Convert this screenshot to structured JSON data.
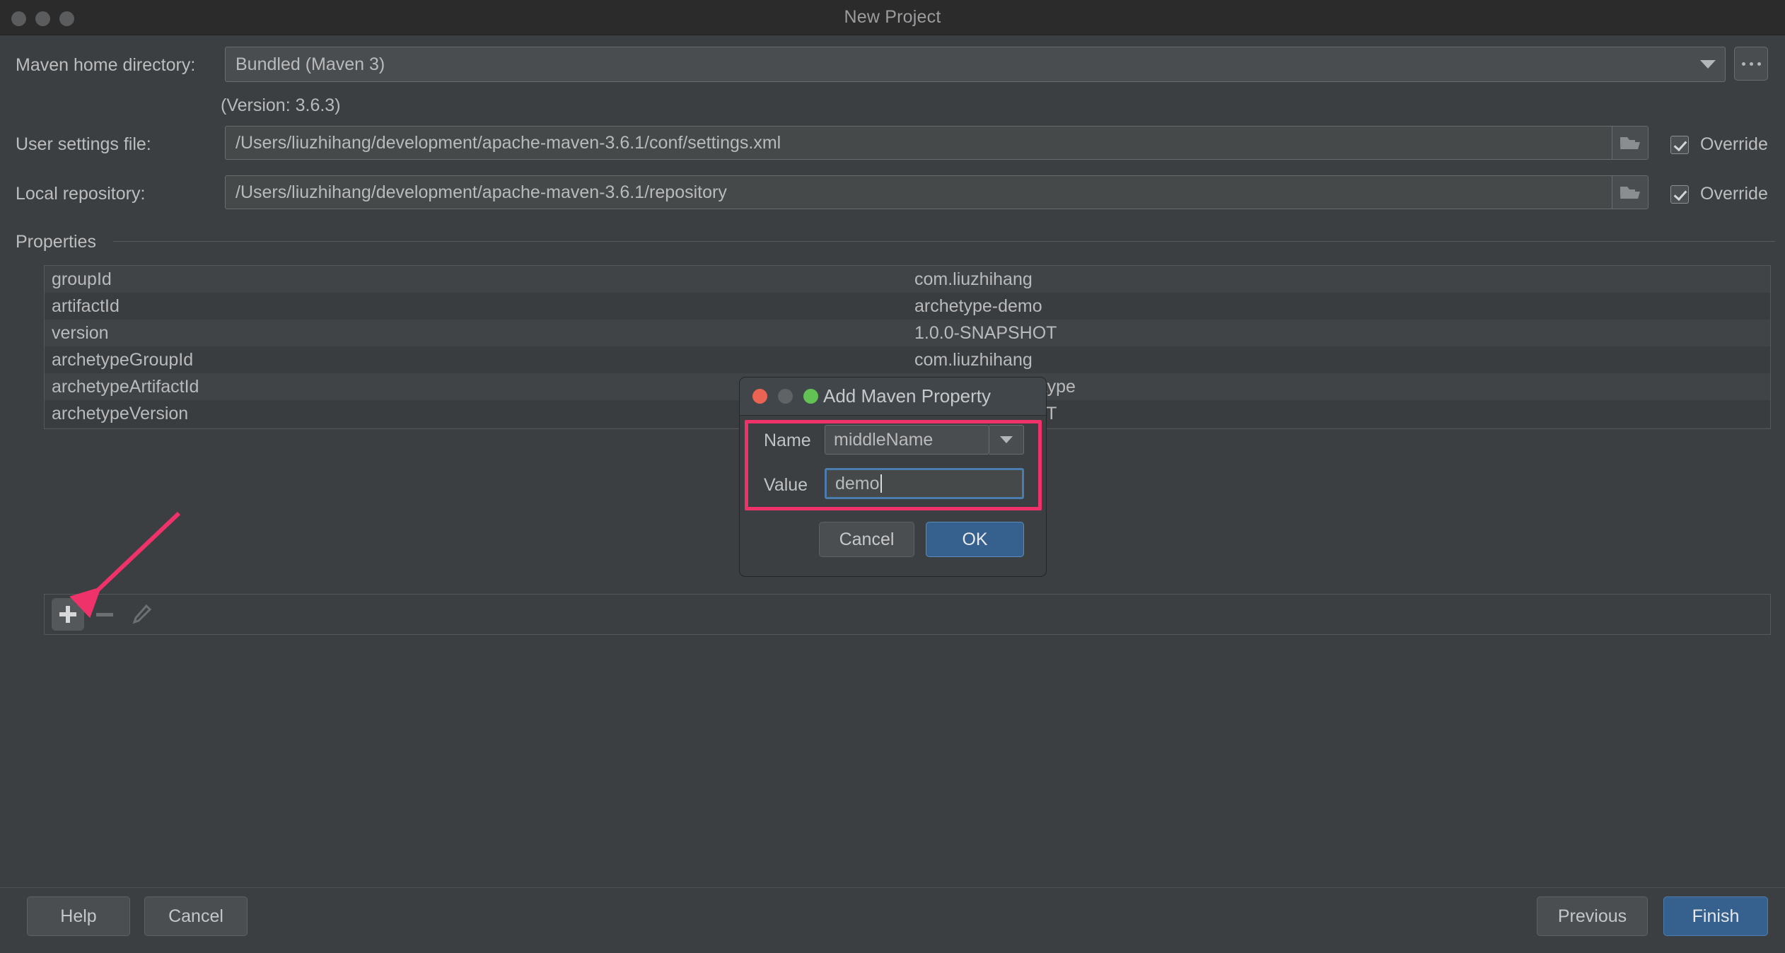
{
  "window": {
    "title": "New Project",
    "traffic_lights": [
      "close-button",
      "minimize-button",
      "zoom-button"
    ]
  },
  "form": {
    "maven_home_label": "Maven home directory:",
    "maven_home_value": "Bundled (Maven 3)",
    "version_note": "(Version: 3.6.3)",
    "user_settings_label": "User settings file:",
    "user_settings_value": "/Users/liuzhihang/development/apache-maven-3.6.1/conf/settings.xml",
    "user_settings_override": "Override",
    "local_repo_label": "Local repository:",
    "local_repo_value": "/Users/liuzhihang/development/apache-maven-3.6.1/repository",
    "local_repo_override": "Override",
    "browse_button": "..."
  },
  "properties": {
    "group_label": "Properties",
    "rows": [
      {
        "name": "groupId",
        "value": "com.liuzhihang"
      },
      {
        "name": "artifactId",
        "value": "archetype-demo"
      },
      {
        "name": "version",
        "value": "1.0.0-SNAPSHOT"
      },
      {
        "name": "archetypeGroupId",
        "value": "com.liuzhihang"
      },
      {
        "name": "archetypeArtifactId",
        "value": "archetype-archetype"
      },
      {
        "name": "archetypeVersion",
        "value": "1.0.0-SNAPSHOT"
      }
    ],
    "toolbar": {
      "add": "+",
      "remove": "—",
      "edit": "edit-pencil"
    }
  },
  "footer": {
    "help": "Help",
    "cancel": "Cancel",
    "previous": "Previous",
    "finish": "Finish"
  },
  "modal": {
    "title": "Add Maven Property",
    "name_label": "Name",
    "name_value": "middleName",
    "value_label": "Value",
    "value_value": "demo",
    "cancel": "Cancel",
    "ok": "OK"
  },
  "annotations": {
    "highlight_color": "#f0326a",
    "arrow_color": "#f0326a"
  },
  "colors": {
    "background": "#3c3f41",
    "titlebar": "#2b2b2b",
    "accent_blue": "#36618e",
    "field": "#4a4d4f",
    "text": "#b9babc"
  }
}
